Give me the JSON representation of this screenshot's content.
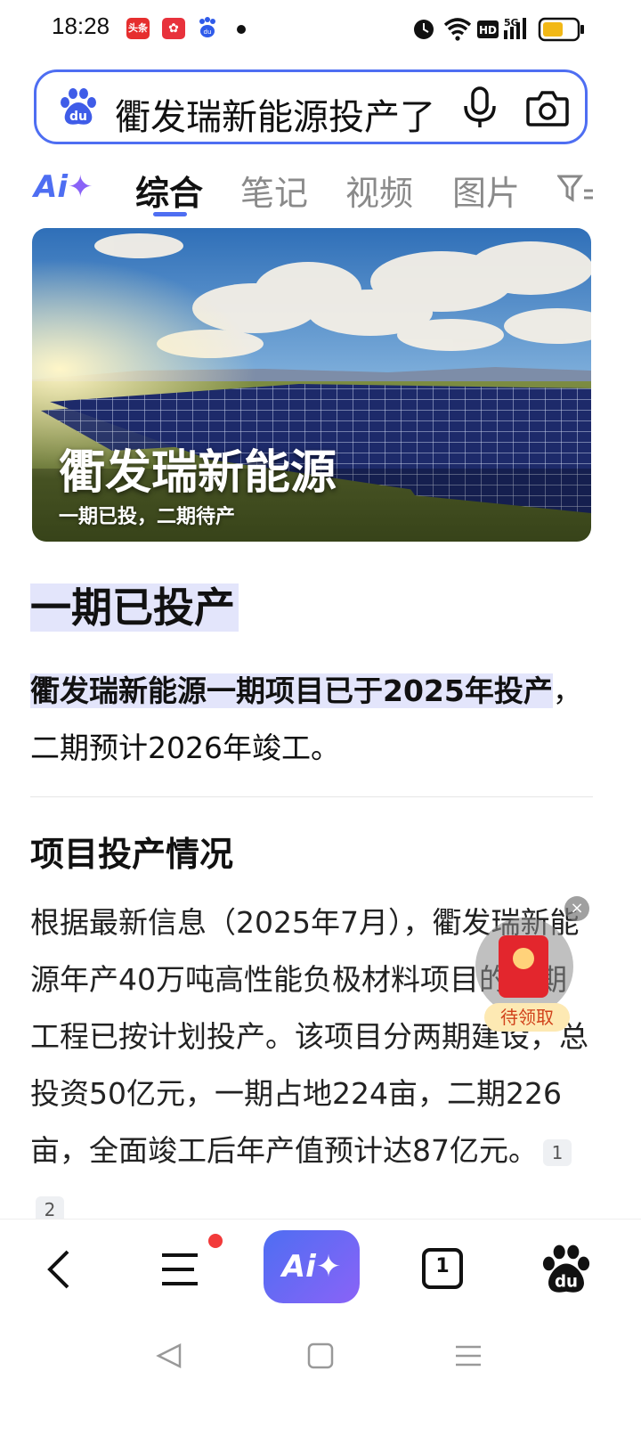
{
  "status_bar": {
    "time": "18:28",
    "app_badge_1": "头条",
    "network": "5G",
    "hd": "HD"
  },
  "search": {
    "query": "衢发瑞新能源投产了"
  },
  "tabs": {
    "ai": "Ai",
    "items": [
      "综合",
      "笔记",
      "视频",
      "图片"
    ]
  },
  "hero": {
    "title": "衢发瑞新能源",
    "subtitle": "一期已投，二期待产"
  },
  "answer": {
    "heading": "一期已投产",
    "highlight_text": "衢发瑞新能源一期项目已于2025年投产",
    "rest_text": "，二期预计2026年竣工。"
  },
  "section": {
    "heading": "项目投产情况",
    "body": "根据最新信息（2025年7月），衢发瑞新能源年产40万吨高性能负极材料项目的一期工程已按计划投产。该项目分两期建设，总投资50亿元，一期占地224亩，二期226亩，全面竣工后年产值预计达87亿元。",
    "citations": [
      "1",
      "2"
    ]
  },
  "red_envelope": {
    "label": "待领取",
    "close": "×"
  },
  "bottom_bar": {
    "ai_label": "Ai✦",
    "tab_count": "1"
  }
}
